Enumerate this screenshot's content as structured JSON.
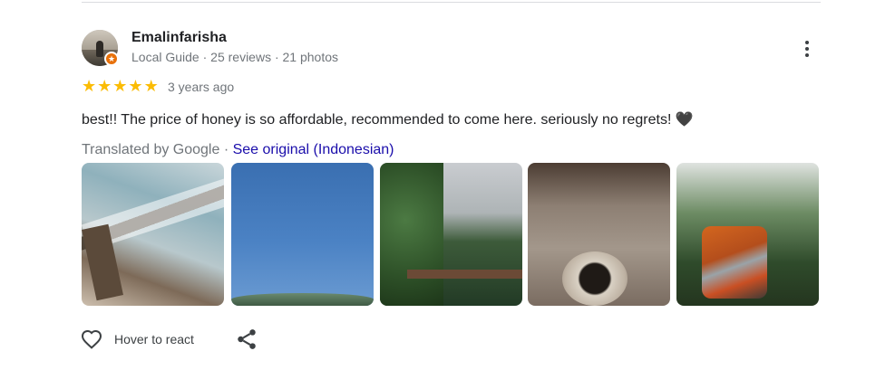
{
  "reviewer": {
    "name": "Emalinfarisha",
    "meta": "Local Guide · 25 reviews · 21 photos"
  },
  "rating": {
    "stars": 5,
    "max": 5
  },
  "review": {
    "date": "3 years ago",
    "text": "best!! The price of honey is so affordable, recommended to come here. seriously no regrets! 🖤",
    "translated_by": "Translated by Google · ",
    "see_original": "See original (Indonesian)"
  },
  "photos": [
    "photo-1",
    "photo-2",
    "photo-3",
    "photo-4",
    "photo-5"
  ],
  "actions": {
    "react_label": "Hover to react",
    "react_icon": "heart-icon",
    "share_icon": "share-icon",
    "more_icon": "more-vert-icon"
  },
  "colors": {
    "star": "#fbbc04",
    "link": "#1a0dab",
    "muted": "#70757a",
    "guide_badge": "#e8710a"
  }
}
